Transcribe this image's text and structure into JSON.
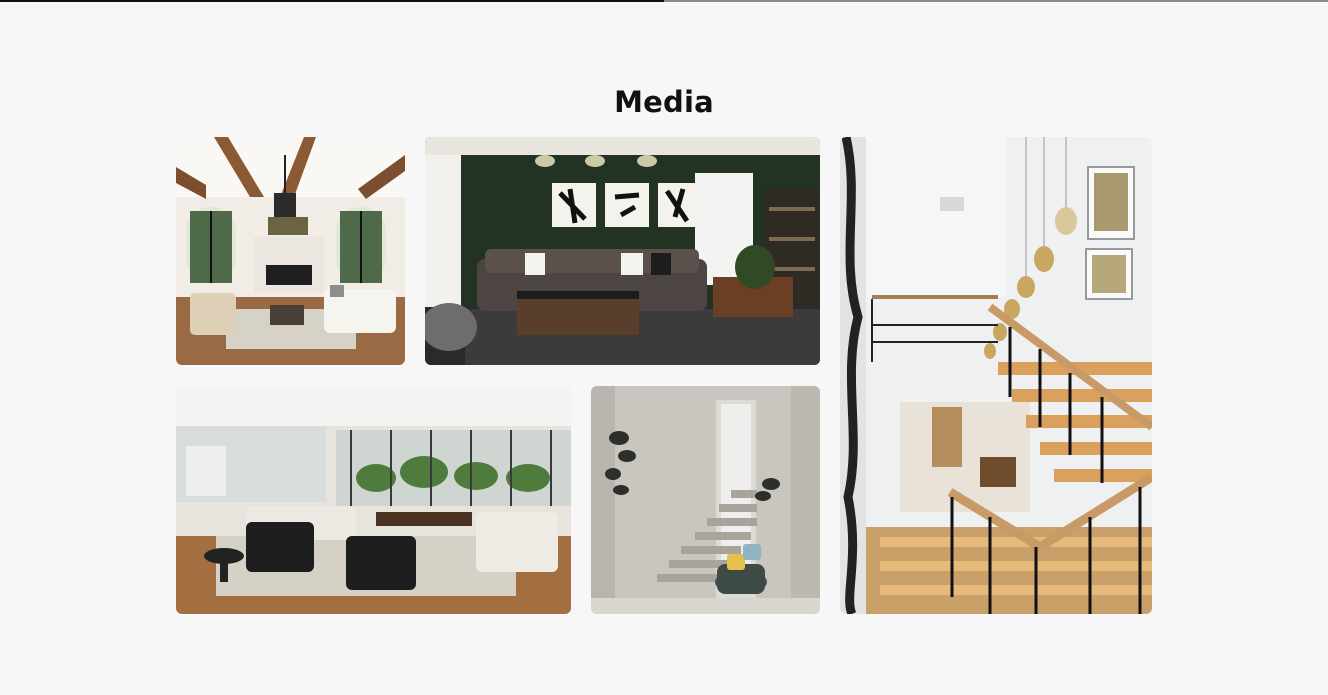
{
  "section": {
    "title": "Media"
  },
  "gallery": {
    "items": [
      {
        "name": "living-room-wood-beams-photo",
        "icon": "image"
      },
      {
        "name": "dark-green-lounge-photo",
        "icon": "image"
      },
      {
        "name": "staircase-pendant-lights-photo",
        "icon": "image"
      },
      {
        "name": "open-plan-living-room-photo",
        "icon": "image"
      },
      {
        "name": "minimal-stairs-chair-photo",
        "icon": "image"
      }
    ]
  }
}
